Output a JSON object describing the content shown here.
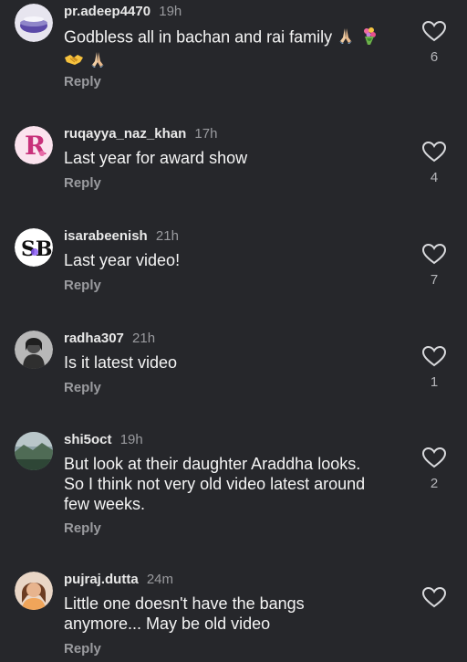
{
  "comments": [
    {
      "username": "pr.adeep4470",
      "time": "19h",
      "text_line1": "Godbless all in bachan and rai family",
      "text_line2": "",
      "likes": "6",
      "reply_label": "Reply",
      "avatar_icon": "globe-avatar-icon",
      "emojis": [
        "praying-hands",
        "bouquet",
        "handshake",
        "praying-hands"
      ]
    },
    {
      "username": "ruqayya_naz_khan",
      "time": "17h",
      "text_line1": "Last year for award show",
      "text_line2": "",
      "likes": "4",
      "reply_label": "Reply",
      "avatar_icon": "letter-r-avatar-icon",
      "avatar_letter": "R"
    },
    {
      "username": "isarabeenish",
      "time": "21h",
      "text_line1": "Last year video!",
      "text_line2": "",
      "likes": "7",
      "reply_label": "Reply",
      "avatar_icon": "monogram-avatar-icon",
      "avatar_letter": "SB"
    },
    {
      "username": "radha307",
      "time": "21h",
      "text_line1": "Is it latest video",
      "text_line2": "",
      "likes": "1",
      "reply_label": "Reply",
      "avatar_icon": "portrait-avatar-icon"
    },
    {
      "username": "shi5oct",
      "time": "19h",
      "text_line1": "But look at their daughter Araddha looks.",
      "text_line2": "So I think not very old video latest around",
      "text_line3": "few weeks.",
      "likes": "2",
      "reply_label": "Reply",
      "avatar_icon": "landscape-avatar-icon"
    },
    {
      "username": "pujraj.dutta",
      "time": "24m",
      "text_line1": "Little one doesn't have the bangs",
      "text_line2": "anymore... May be old video",
      "likes": "",
      "reply_label": "Reply",
      "avatar_icon": "portrait-avatar-icon"
    }
  ],
  "colors": {
    "background": "#26272b",
    "text": "#f4f4f4",
    "muted": "#9a9b9f"
  },
  "icons": {
    "like": "heart-outline-icon"
  }
}
